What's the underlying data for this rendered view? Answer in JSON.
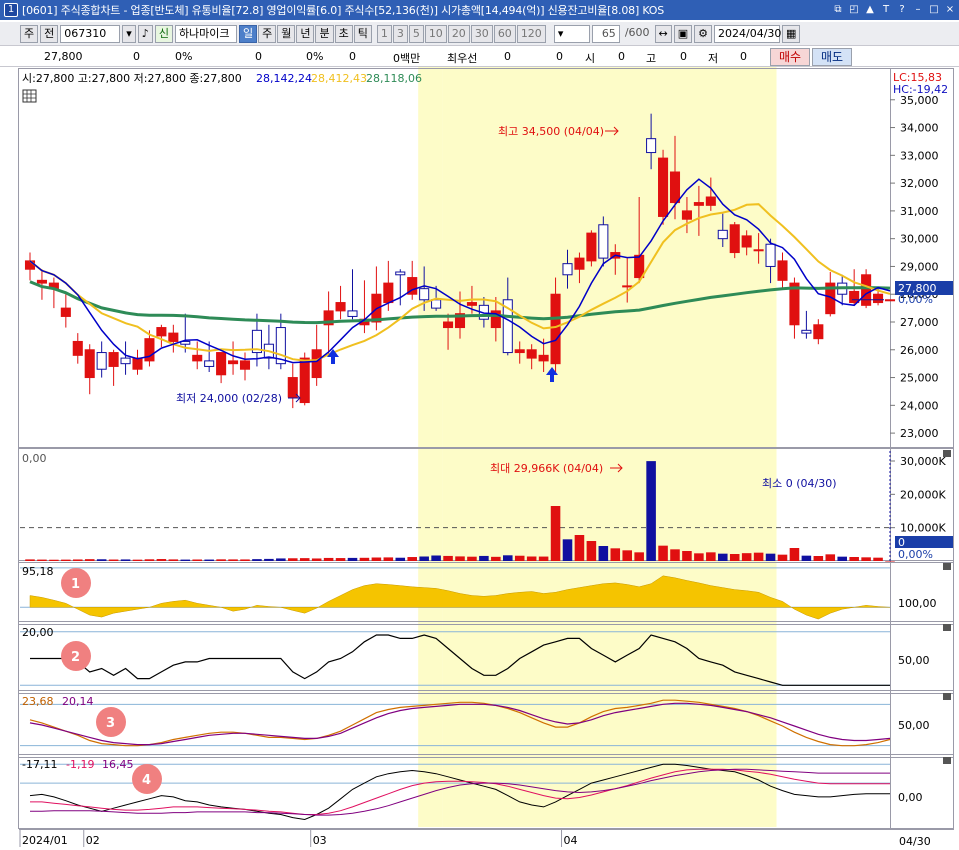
{
  "window": {
    "number": "1",
    "title": "[0601] 주식종합차트 - 업종[반도체] 유통비율[72.8] 영업이익률[6.0] 주식수[52,136(천)] 시가총액[14,494(억)] 신용잔고비율[8.08] KOS",
    "buttons": [
      "⧉",
      "◰",
      "▲",
      "T",
      "?",
      "–",
      "□",
      "×"
    ]
  },
  "toolbar": {
    "market": "주",
    "prev_label": "전",
    "code": "067310",
    "name": "하나마이크",
    "credit_label": "신",
    "periods": [
      {
        "label": "일",
        "selected": true
      },
      {
        "label": "주",
        "selected": false
      },
      {
        "label": "월",
        "selected": false
      },
      {
        "label": "년",
        "selected": false
      },
      {
        "label": "분",
        "selected": false
      },
      {
        "label": "초",
        "selected": false
      },
      {
        "label": "틱",
        "selected": false
      }
    ],
    "intervals": [
      "1",
      "3",
      "5",
      "10",
      "20",
      "30",
      "60",
      "120"
    ],
    "count": "65",
    "total": "/600",
    "date": "2024/04/30"
  },
  "inforow": {
    "price": "27,800",
    "change": "0",
    "change_pct": "0%",
    "vol": "0",
    "vol_pct": "0%",
    "val": "0",
    "val_pct": "0%",
    "amount": "0백만",
    "best_label": "최우선",
    "best_a": "0",
    "best_b": "0",
    "open_label": "시",
    "open": "0",
    "high_label": "고",
    "high": "0",
    "low_label": "저",
    "low": "0",
    "buy": "매수",
    "sell": "매도"
  },
  "price_panel": {
    "ohlc_text": "시:27,800 고:27,800 저:27,800 종:27,800",
    "ma_values": [
      {
        "value": "28,142,24",
        "color": "#0000c8"
      },
      {
        "value": "28,412,43",
        "color": "#f0c020"
      },
      {
        "value": "28,118,06",
        "color": "#2e8b57"
      }
    ],
    "lc": "LC:15,83",
    "hc": "HC:-19,42",
    "current_price": "27,800",
    "current_pct": "0,00%",
    "ymin": 22500,
    "ymax": 36000,
    "ticks": [
      "23,000",
      "24,000",
      "25,000",
      "26,000",
      "27,000",
      "28,000",
      "29,000",
      "30,000",
      "31,000",
      "32,000",
      "33,000",
      "34,000",
      "35,000"
    ],
    "max_annotation": "최고 34,500 (04/04)",
    "min_annotation": "최저 24,000 (02/28)"
  },
  "volume_panel": {
    "label": "0,00",
    "ticks": [
      "10,000K",
      "20,000K",
      "30,000K"
    ],
    "max_annotation": "최대 29,966K (04/04)",
    "min_annotation": "최소 0 (04/30)",
    "current": "0",
    "current_pct": "0,00%"
  },
  "ind1": {
    "legend": "95,18",
    "tick": "100,00",
    "badge": "1"
  },
  "ind2": {
    "legend": "20,00",
    "tick": "50,00",
    "badge": "2"
  },
  "ind3": {
    "legend_a": "23,68",
    "legend_b": "20,14",
    "tick": "50,00",
    "badge": "3"
  },
  "ind4": {
    "legend_a": "-17,11",
    "legend_b": "-1,19",
    "legend_c": "16,45",
    "tick": "0,00",
    "badge": "4"
  },
  "xaxis": {
    "labels": [
      {
        "text": "2024/01",
        "idx": 0
      },
      {
        "text": "02",
        "idx": 5
      },
      {
        "text": "03",
        "idx": 24
      },
      {
        "text": "04",
        "idx": 45
      }
    ],
    "end_label": "04/30"
  },
  "chart_data": {
    "type": "candlestick",
    "series": [
      {
        "name": "OHLC",
        "ohlc": [
          [
            28900,
            29500,
            28500,
            29200
          ],
          [
            28400,
            28900,
            27800,
            28500
          ],
          [
            28200,
            28600,
            27500,
            28400
          ],
          [
            27200,
            28000,
            26800,
            27500
          ],
          [
            25800,
            26600,
            25500,
            26300
          ],
          [
            25000,
            26200,
            24400,
            26000
          ],
          [
            25900,
            26300,
            25000,
            25300
          ],
          [
            25400,
            26000,
            24700,
            25900
          ],
          [
            25700,
            26300,
            25100,
            25500
          ],
          [
            25300,
            26000,
            25100,
            25700
          ],
          [
            25600,
            26700,
            25400,
            26400
          ],
          [
            26500,
            26900,
            26100,
            26800
          ],
          [
            26300,
            26900,
            25900,
            26600
          ],
          [
            26300,
            27300,
            25900,
            26200
          ],
          [
            25600,
            26300,
            25300,
            25800
          ],
          [
            25600,
            26300,
            25200,
            25400
          ],
          [
            25100,
            25800,
            24800,
            25900
          ],
          [
            25500,
            26300,
            25100,
            25600
          ],
          [
            25300,
            25900,
            24900,
            25600
          ],
          [
            26700,
            27300,
            25400,
            25900
          ],
          [
            26200,
            26900,
            25300,
            25700
          ],
          [
            26800,
            27300,
            25300,
            25500
          ],
          [
            24300,
            25500,
            23900,
            25000
          ],
          [
            24100,
            25900,
            24000,
            25700
          ],
          [
            25000,
            26900,
            24700,
            26000
          ],
          [
            26900,
            28100,
            25800,
            27400
          ],
          [
            27400,
            28300,
            27100,
            27700
          ],
          [
            27400,
            28900,
            27100,
            27200
          ],
          [
            26900,
            28500,
            26600,
            27100
          ],
          [
            27000,
            29000,
            26700,
            28000
          ],
          [
            27700,
            29200,
            27400,
            28400
          ],
          [
            28800,
            28900,
            27600,
            28700
          ],
          [
            28000,
            29200,
            27800,
            28600
          ],
          [
            28200,
            29000,
            27400,
            27800
          ],
          [
            27800,
            28300,
            27400,
            27500
          ],
          [
            26800,
            27300,
            26000,
            27000
          ],
          [
            26800,
            28100,
            26400,
            27300
          ],
          [
            27600,
            28300,
            27300,
            27700
          ],
          [
            27600,
            27900,
            26800,
            27100
          ],
          [
            26800,
            27900,
            26300,
            27400
          ],
          [
            27800,
            28600,
            25800,
            25900
          ],
          [
            25900,
            26300,
            25500,
            26000
          ],
          [
            25700,
            26200,
            25300,
            26000
          ],
          [
            25600,
            26400,
            25200,
            25800
          ],
          [
            25500,
            28600,
            25200,
            28000
          ],
          [
            29100,
            29600,
            28200,
            28700
          ],
          [
            28900,
            29500,
            28400,
            29300
          ],
          [
            29200,
            30300,
            29000,
            30200
          ],
          [
            30500,
            30800,
            29000,
            29300
          ],
          [
            29300,
            29800,
            28700,
            29500
          ],
          [
            28300,
            29300,
            27700,
            28300
          ],
          [
            28600,
            31500,
            28400,
            29400
          ],
          [
            33600,
            34500,
            32500,
            33100
          ],
          [
            30800,
            33200,
            30500,
            32900
          ],
          [
            31300,
            33700,
            30700,
            32400
          ],
          [
            30700,
            31500,
            30200,
            31000
          ],
          [
            31200,
            31900,
            30100,
            31300
          ],
          [
            31200,
            32200,
            31000,
            31500
          ],
          [
            30300,
            30900,
            29700,
            30000
          ],
          [
            29500,
            30600,
            29300,
            30500
          ],
          [
            29700,
            30300,
            29400,
            30100
          ],
          [
            29600,
            30200,
            29100,
            29600
          ],
          [
            29800,
            30000,
            28400,
            29000
          ],
          [
            28500,
            29500,
            28200,
            29200
          ],
          [
            26900,
            28600,
            26400,
            28400
          ],
          [
            26700,
            27400,
            26400,
            26600
          ],
          [
            26400,
            27100,
            26200,
            26900
          ],
          [
            27300,
            28800,
            27200,
            28400
          ],
          [
            28400,
            28700,
            27600,
            28000
          ],
          [
            27700,
            28900,
            27600,
            28100
          ],
          [
            27600,
            28900,
            27500,
            28700
          ],
          [
            27700,
            28200,
            27600,
            28000
          ],
          [
            27800,
            27800,
            27800,
            27800
          ]
        ]
      },
      {
        "name": "Volume",
        "values": [
          480,
          420,
          380,
          410,
          460,
          550,
          520,
          440,
          470,
          400,
          510,
          590,
          480,
          420,
          450,
          430,
          500,
          480,
          470,
          560,
          630,
          770,
          820,
          860,
          760,
          920,
          880,
          930,
          960,
          1050,
          1080,
          980,
          1190,
          1350,
          1650,
          1520,
          1380,
          1290,
          1520,
          1250,
          1710,
          1580,
          1350,
          1330,
          16500,
          6500,
          7800,
          6000,
          4500,
          3800,
          3200,
          2600,
          29966,
          4600,
          3500,
          3000,
          2300,
          2600,
          2200,
          2100,
          2350,
          2500,
          2200,
          1900,
          3900,
          1600,
          1500,
          2000,
          1300,
          1200,
          1100,
          1000,
          0
        ]
      },
      {
        "name": "Ind1",
        "values": [
          30,
          25,
          18,
          10,
          -5,
          -20,
          -25,
          -15,
          -10,
          -5,
          0,
          10,
          15,
          18,
          10,
          5,
          0,
          -10,
          -5,
          5,
          2,
          0,
          -8,
          -15,
          -2,
          15,
          30,
          45,
          55,
          60,
          58,
          55,
          52,
          50,
          48,
          42,
          35,
          30,
          28,
          30,
          35,
          38,
          40,
          35,
          38,
          45,
          50,
          55,
          60,
          62,
          58,
          52,
          60,
          80,
          75,
          68,
          62,
          55,
          50,
          45,
          42,
          38,
          25,
          15,
          -5,
          -20,
          -30,
          -15,
          -5,
          0,
          5,
          2,
          0
        ]
      },
      {
        "name": "Ind2",
        "values": [
          60,
          60,
          60,
          60,
          55,
          40,
          45,
          35,
          45,
          30,
          30,
          40,
          50,
          55,
          55,
          60,
          60,
          60,
          60,
          60,
          60,
          60,
          40,
          30,
          40,
          55,
          60,
          70,
          85,
          95,
          95,
          90,
          90,
          95,
          90,
          75,
          60,
          45,
          35,
          35,
          45,
          60,
          70,
          80,
          85,
          90,
          90,
          75,
          65,
          55,
          65,
          75,
          95,
          90,
          85,
          75,
          60,
          55,
          50,
          40,
          35,
          30,
          25,
          20,
          20,
          20,
          20,
          20,
          20,
          20,
          20,
          20,
          20
        ]
      },
      {
        "name": "Ind3A",
        "values": [
          55,
          52,
          48,
          44,
          40,
          35,
          32,
          31,
          30,
          30,
          31,
          33,
          36,
          38,
          40,
          42,
          43,
          43,
          42,
          40,
          38,
          38,
          37,
          36,
          37,
          40,
          44,
          50,
          56,
          62,
          65,
          67,
          68,
          69,
          70,
          71,
          72,
          72,
          71,
          69,
          66,
          62,
          57,
          52,
          48,
          48,
          52,
          58,
          63,
          66,
          67,
          69,
          71,
          74,
          74,
          73,
          72,
          70,
          68,
          66,
          63,
          59,
          54,
          49,
          43,
          38,
          34,
          31,
          30,
          30,
          31,
          33,
          36
        ]
      },
      {
        "name": "Ind3B",
        "values": [
          52,
          50,
          47,
          44,
          41,
          38,
          35,
          33,
          32,
          31,
          31,
          32,
          34,
          36,
          38,
          40,
          41,
          42,
          42,
          41,
          40,
          39,
          38,
          37,
          37,
          39,
          42,
          47,
          52,
          57,
          61,
          64,
          66,
          67,
          68,
          69,
          70,
          70,
          70,
          69,
          67,
          64,
          60,
          56,
          53,
          51,
          52,
          55,
          59,
          62,
          64,
          66,
          68,
          70,
          71,
          71,
          70,
          69,
          67,
          65,
          63,
          60,
          57,
          53,
          49,
          45,
          41,
          38,
          36,
          35,
          35,
          36,
          37
        ]
      },
      {
        "name": "Ind4A",
        "values": [
          -20,
          -18,
          -22,
          -28,
          -35,
          -40,
          -45,
          -40,
          -35,
          -30,
          -25,
          -20,
          -22,
          -28,
          -30,
          -35,
          -38,
          -40,
          -42,
          -45,
          -48,
          -50,
          -55,
          -58,
          -50,
          -40,
          -25,
          -10,
          0,
          10,
          15,
          18,
          20,
          18,
          15,
          10,
          5,
          0,
          -5,
          -10,
          -20,
          -30,
          -35,
          -38,
          -30,
          -20,
          -10,
          0,
          5,
          10,
          15,
          20,
          25,
          30,
          30,
          28,
          25,
          22,
          20,
          18,
          12,
          5,
          -5,
          -12,
          -18,
          -20,
          -22,
          -22,
          -20,
          -18,
          -17,
          -17,
          -17
        ]
      },
      {
        "name": "Ind4B",
        "values": [
          -30,
          -30,
          -32,
          -34,
          -36,
          -38,
          -40,
          -42,
          -43,
          -43,
          -42,
          -40,
          -38,
          -38,
          -38,
          -39,
          -40,
          -41,
          -42,
          -43,
          -45,
          -46,
          -48,
          -50,
          -50,
          -48,
          -44,
          -38,
          -31,
          -24,
          -17,
          -10,
          -4,
          0,
          2,
          3,
          3,
          2,
          1,
          -1,
          -5,
          -10,
          -15,
          -20,
          -24,
          -25,
          -23,
          -19,
          -14,
          -9,
          -4,
          2,
          8,
          13,
          18,
          21,
          22,
          22,
          22,
          21,
          19,
          17,
          14,
          10,
          6,
          3,
          0,
          -1,
          -1,
          -1,
          -1,
          -1,
          -1
        ]
      },
      {
        "name": "Ind4C",
        "values": [
          -45,
          -45,
          -44,
          -44,
          -44,
          -44,
          -45,
          -46,
          -47,
          -48,
          -48,
          -48,
          -47,
          -47,
          -46,
          -46,
          -46,
          -46,
          -46,
          -47,
          -47,
          -48,
          -49,
          -50,
          -51,
          -51,
          -50,
          -48,
          -45,
          -41,
          -36,
          -30,
          -24,
          -18,
          -12,
          -7,
          -3,
          -1,
          0,
          0,
          -1,
          -3,
          -6,
          -9,
          -12,
          -14,
          -15,
          -14,
          -12,
          -9,
          -5,
          -1,
          4,
          8,
          12,
          15,
          18,
          20,
          21,
          22,
          22,
          21,
          20,
          19,
          18,
          17,
          16,
          16,
          16,
          16,
          16,
          16,
          16
        ]
      }
    ],
    "moving_averages": [
      {
        "name": "MA5",
        "color": "#0000c8"
      },
      {
        "name": "MA20",
        "color": "#f0c020"
      },
      {
        "name": "MA60",
        "color": "#2e8b57"
      }
    ],
    "highlights": [
      [
        33,
        34
      ],
      [
        35,
        62
      ]
    ],
    "up_color": "#e01010",
    "down_color": "#1010a0"
  }
}
